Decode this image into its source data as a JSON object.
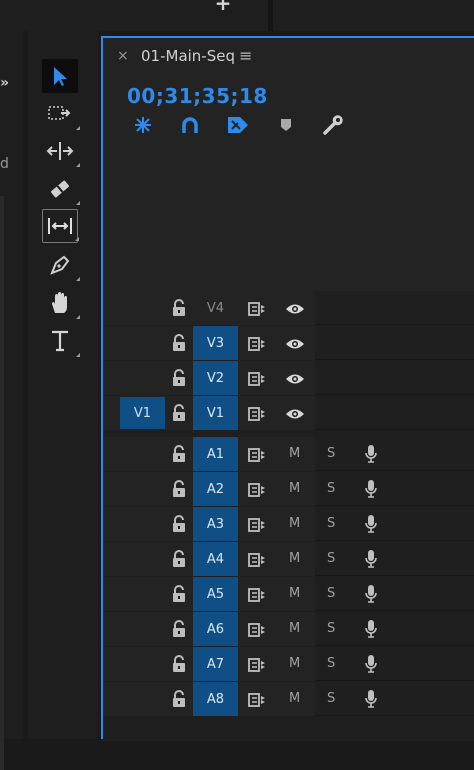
{
  "top_bar": {
    "add_label": "+"
  },
  "left_panel": {
    "chevron": "»",
    "letter": "d"
  },
  "tools": [
    {
      "name": "selection-tool",
      "active": true
    },
    {
      "name": "track-select-forward-tool"
    },
    {
      "name": "ripple-edit-tool"
    },
    {
      "name": "razor-tool"
    },
    {
      "name": "slip-tool",
      "boxed": true
    },
    {
      "name": "pen-tool"
    },
    {
      "name": "hand-tool"
    },
    {
      "name": "type-tool"
    }
  ],
  "timeline": {
    "close_label": "×",
    "sequence_name": "01-Main-Seq",
    "menu_label": "≡",
    "timecode": "00;31;35;18",
    "accent_color": "#2d8ceb",
    "toolbar_icons": [
      "snap-in-timeline-icon",
      "linked-selection-icon",
      "add-marker-icon",
      "marker-icon",
      "timeline-settings-wrench-icon"
    ]
  },
  "video_tracks": [
    {
      "label": "V4",
      "targeted": false,
      "source": ""
    },
    {
      "label": "V3",
      "targeted": true,
      "source": ""
    },
    {
      "label": "V2",
      "targeted": true,
      "source": ""
    },
    {
      "label": "V1",
      "targeted": true,
      "source": "V1"
    }
  ],
  "audio_tracks": [
    {
      "label": "A1",
      "mute": "M",
      "solo": "S"
    },
    {
      "label": "A2",
      "mute": "M",
      "solo": "S"
    },
    {
      "label": "A3",
      "mute": "M",
      "solo": "S"
    },
    {
      "label": "A4",
      "mute": "M",
      "solo": "S"
    },
    {
      "label": "A5",
      "mute": "M",
      "solo": "S"
    },
    {
      "label": "A6",
      "mute": "M",
      "solo": "S"
    },
    {
      "label": "A7",
      "mute": "M",
      "solo": "S"
    },
    {
      "label": "A8",
      "mute": "M",
      "solo": "S"
    }
  ],
  "colors": {
    "panel": "#232323",
    "target_blue": "#0f4f86",
    "accent": "#2d8ceb"
  }
}
